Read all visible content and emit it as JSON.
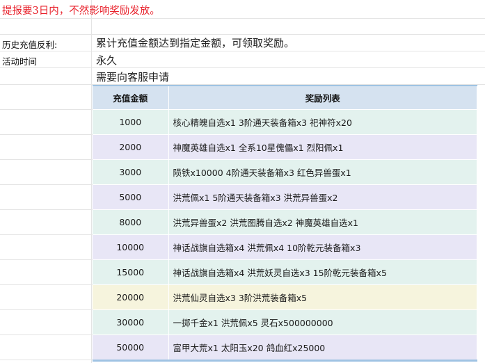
{
  "notice": "提报要3日内，不然影响奖励发放。",
  "info": {
    "history_label": "历史充值反利:",
    "history_value": "累计充值金额达到指定金额，可领取奖励。",
    "time_label": "活动时间",
    "time_value": "永久",
    "apply_value": "需要向客服申请"
  },
  "table": {
    "headers": [
      "充值金额",
      "奖励列表"
    ],
    "rows": [
      {
        "amount": "1000",
        "reward": "核心精魄自选x1 3阶通天装备箱x3 祀神符x20",
        "color": "#e3f2ee"
      },
      {
        "amount": "2000",
        "reward": "神魔英雄自选x1 全系10星傀儡x1 烈阳佩x1",
        "color": "#e8e6f6"
      },
      {
        "amount": "3000",
        "reward": "陨铁x10000 4阶通天装备箱x3 红色异兽蛋x1",
        "color": "#e3f2ee"
      },
      {
        "amount": "5000",
        "reward": "洪荒佩x1 5阶通天装备箱x3 洪荒异兽蛋x2",
        "color": "#e8e6f6"
      },
      {
        "amount": "8000",
        "reward": "洪荒异兽蛋x2 洪荒图腾自选x2 神魔英雄自选x1",
        "color": "#e3f2ee"
      },
      {
        "amount": "10000",
        "reward": "神话战旗自选箱x4 洪荒佩x4 10阶乾元装备箱x3",
        "color": "#e8e6f6"
      },
      {
        "amount": "15000",
        "reward": "神话战旗自选箱x4 洪荒妖灵自选x3 15阶乾元装备箱x5",
        "color": "#e3f2ee"
      },
      {
        "amount": "20000",
        "reward": "洪荒仙灵自选x3 3阶洪荒装备箱x5",
        "color": "#f6f4dd"
      },
      {
        "amount": "30000",
        "reward": "一掷千金x1 洪荒佩x5 灵石x500000000",
        "color": "#e3f2ee"
      },
      {
        "amount": "50000",
        "reward": "富甲大荒x1 太阳玉x20 鸽血红x25000",
        "color": "#e8e6f6"
      }
    ]
  }
}
